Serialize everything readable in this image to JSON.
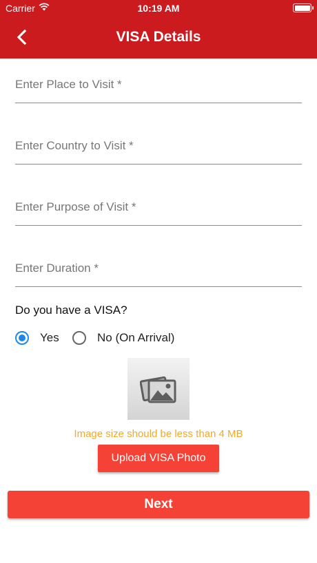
{
  "status_bar": {
    "carrier": "Carrier",
    "time": "10:19 AM"
  },
  "header": {
    "title": "VISA Details",
    "back_icon": "chevron-left-icon"
  },
  "form": {
    "place_placeholder": "Enter Place to Visit *",
    "country_placeholder": "Enter Country to Visit *",
    "purpose_placeholder": "Enter Purpose of Visit *",
    "duration_placeholder": "Enter Duration *"
  },
  "visa_question": {
    "label": "Do you have a VISA?",
    "options": [
      {
        "label": "Yes",
        "selected": true
      },
      {
        "label": "No (On Arrival)",
        "selected": false
      }
    ]
  },
  "upload": {
    "image_icon": "image-placeholder-icon",
    "hint": "Image size should be less than 4 MB",
    "button_label": "Upload VISA Photo"
  },
  "next_label": "Next",
  "colors": {
    "header": "#cc1b1f",
    "button": "#f44336",
    "hint": "#f0a92b",
    "radio": "#1e88e5"
  }
}
